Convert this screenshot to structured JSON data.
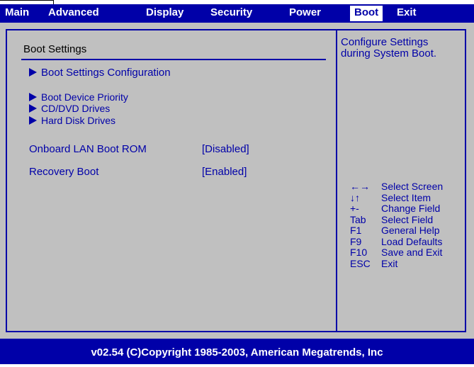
{
  "menu": {
    "tabs": [
      {
        "label": "Main"
      },
      {
        "label": "Advanced"
      },
      {
        "label": "Display"
      },
      {
        "label": "Security"
      },
      {
        "label": "Power"
      },
      {
        "label": "Boot",
        "active": true
      },
      {
        "label": "Exit"
      }
    ]
  },
  "main": {
    "section_title": "Boot Settings",
    "submenus": [
      {
        "label": "Boot Settings Configuration"
      },
      {
        "label": "Boot Device Priority"
      },
      {
        "label": "CD/DVD Drives"
      },
      {
        "label": "Hard Disk Drives"
      }
    ],
    "settings": [
      {
        "label": "Onboard LAN Boot ROM",
        "value": "[Disabled]"
      },
      {
        "label": "Recovery Boot",
        "value": "[Enabled]"
      }
    ]
  },
  "help": {
    "text_line1": "Configure Settings",
    "text_line2": "during System Boot.",
    "keys": [
      {
        "key": "←→",
        "desc": "Select Screen"
      },
      {
        "key": "↓↑",
        "desc": "Select Item"
      },
      {
        "key": "+-",
        "desc": "Change Field"
      },
      {
        "key": "Tab",
        "desc": "Select Field"
      },
      {
        "key": "F1",
        "desc": "General Help"
      },
      {
        "key": "F9",
        "desc": "Load Defaults"
      },
      {
        "key": "F10",
        "desc": "Save and Exit"
      },
      {
        "key": "ESC",
        "desc": "Exit"
      }
    ]
  },
  "footer": {
    "copyright": "v02.54 (C)Copyright 1985-2003, American Megatrends, Inc"
  },
  "colors": {
    "bios_blue": "#0000a8",
    "panel_gray": "#c0c0c0",
    "text_white": "#ffffff"
  }
}
